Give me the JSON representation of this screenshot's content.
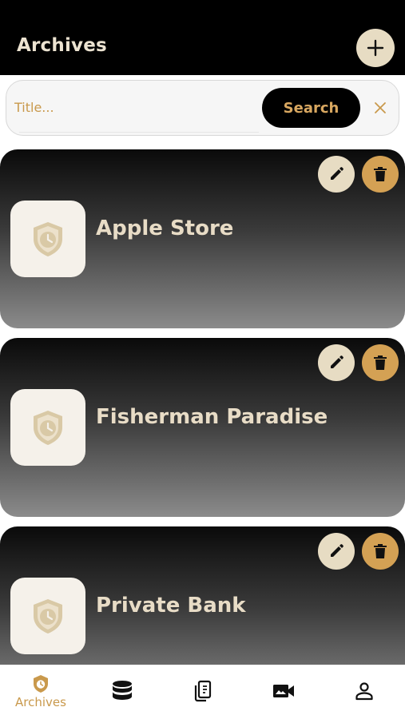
{
  "header": {
    "title": "Archives",
    "add_icon": "plus-icon"
  },
  "search": {
    "placeholder": "Title...",
    "value": "",
    "button_label": "Search",
    "clear_icon": "close-icon"
  },
  "archives": [
    {
      "title": "Apple Store",
      "icon": "shield-clock-icon"
    },
    {
      "title": "Fisherman Paradise",
      "icon": "shield-clock-icon"
    },
    {
      "title": "Private Bank",
      "icon": "shield-clock-icon"
    }
  ],
  "card_actions": {
    "edit_icon": "pencil-icon",
    "delete_icon": "trash-icon"
  },
  "bottom_nav": {
    "items": [
      {
        "label": "Archives",
        "icon": "shield-clock-icon",
        "active": true
      },
      {
        "label": "",
        "icon": "database-icon",
        "active": false
      },
      {
        "label": "",
        "icon": "phone-document-icon",
        "active": false
      },
      {
        "label": "",
        "icon": "video-camera-icon",
        "active": false
      },
      {
        "label": "",
        "icon": "person-icon",
        "active": false
      }
    ]
  },
  "colors": {
    "header_bg": "#000000",
    "accent_gold": "#c9994c",
    "cream": "#e7dcc3",
    "delete_gold": "#d4a154",
    "card_title": "#e8dcc6"
  }
}
